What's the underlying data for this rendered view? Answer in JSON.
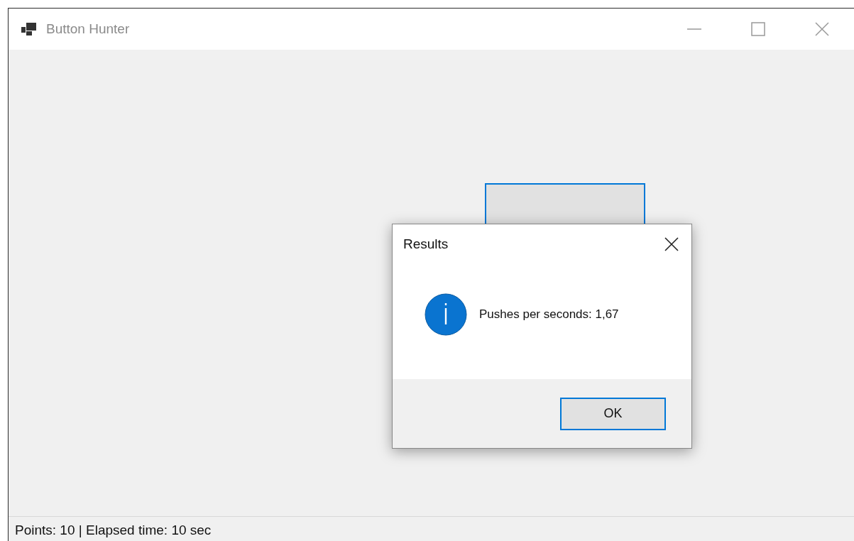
{
  "window": {
    "title": "Button Hunter"
  },
  "game_button": {
    "focused": true
  },
  "dialog": {
    "title": "Results",
    "message": "Pushes per seconds: 1,67",
    "kind": "info",
    "buttons": [
      {
        "label": "OK",
        "focused": true
      }
    ]
  },
  "status_bar": {
    "text": "Points: 10 | Elapsed time: 10 sec"
  }
}
